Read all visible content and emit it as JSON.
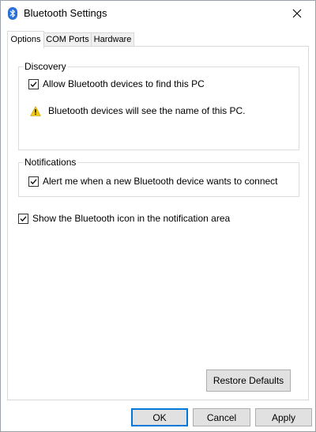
{
  "window": {
    "title": "Bluetooth Settings"
  },
  "tabs": [
    {
      "label": "Options",
      "active": true
    },
    {
      "label": "COM Ports",
      "active": false
    },
    {
      "label": "Hardware",
      "active": false
    }
  ],
  "discovery": {
    "group_label": "Discovery",
    "allow_label": "Allow Bluetooth devices to find this PC",
    "allow_checked": true,
    "warning_text": "Bluetooth devices will see the name of this PC."
  },
  "notifications": {
    "group_label": "Notifications",
    "alert_label": "Alert me when a new Bluetooth device wants to connect",
    "alert_checked": true
  },
  "show_icon": {
    "label": "Show the Bluetooth icon in the notification area",
    "checked": true
  },
  "buttons": {
    "restore_defaults": "Restore Defaults",
    "ok": "OK",
    "cancel": "Cancel",
    "apply": "Apply"
  },
  "colors": {
    "accent": "#0078d7",
    "bluetooth_icon": "#2a6fd6",
    "warning": "#f2c811"
  }
}
